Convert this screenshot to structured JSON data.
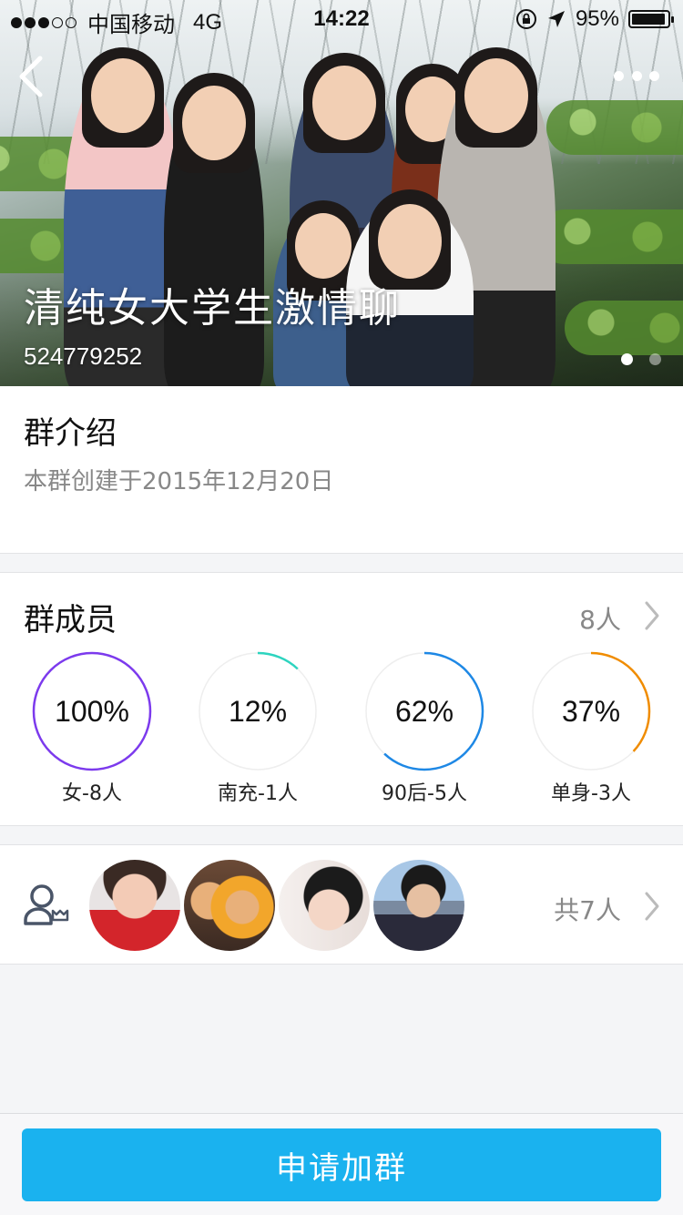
{
  "status_bar": {
    "carrier": "中国移动",
    "network": "4G",
    "time": "14:22",
    "battery_text": "95%",
    "battery_level": 0.95
  },
  "header": {
    "group_name": "清纯女大学生激情聊",
    "group_id": "524779252",
    "pager_total": 2,
    "pager_active": 1
  },
  "intro": {
    "title": "群介绍",
    "text": "本群创建于2015年12月20日"
  },
  "members": {
    "title": "群成员",
    "count_text": "8人",
    "stats": [
      {
        "percent_text": "100%",
        "value": 1.0,
        "label": "女-8人",
        "color": "#7c3aed"
      },
      {
        "percent_text": "12%",
        "value": 0.12,
        "label": "南充-1人",
        "color": "#2dd4bf"
      },
      {
        "percent_text": "62%",
        "value": 0.62,
        "label": "90后-5人",
        "color": "#1e88e5"
      },
      {
        "percent_text": "37%",
        "value": 0.37,
        "label": "单身-3人",
        "color": "#f08c00"
      }
    ]
  },
  "avatars": {
    "count_text": "共7人",
    "items": [
      "avatar-girl-red-sweater",
      "avatar-shiba-dogs",
      "avatar-girl-black-hat",
      "avatar-girl-sunset"
    ]
  },
  "footer": {
    "join_label": "申请加群"
  },
  "colors": {
    "accent": "#1ab2ef",
    "secondary_text": "#888888",
    "background": "#f4f5f7"
  }
}
